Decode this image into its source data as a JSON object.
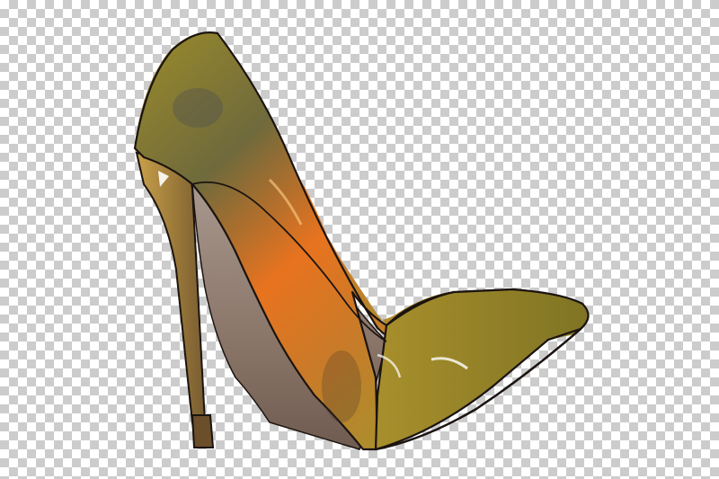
{
  "image": {
    "subject": "watercolor-high-heel-pump-illustration",
    "background": "transparency-checkerboard"
  },
  "colors": {
    "checker_light": "#ffffff",
    "checker_dark": "#cccccc",
    "shoe_olive": "#8f8a2e",
    "shoe_orange": "#e8731f",
    "shoe_mustard": "#b7a12f",
    "insole_mauve": "#8d7a6f",
    "heel_brown": "#7a5a3a",
    "outline": "#1b1410"
  }
}
